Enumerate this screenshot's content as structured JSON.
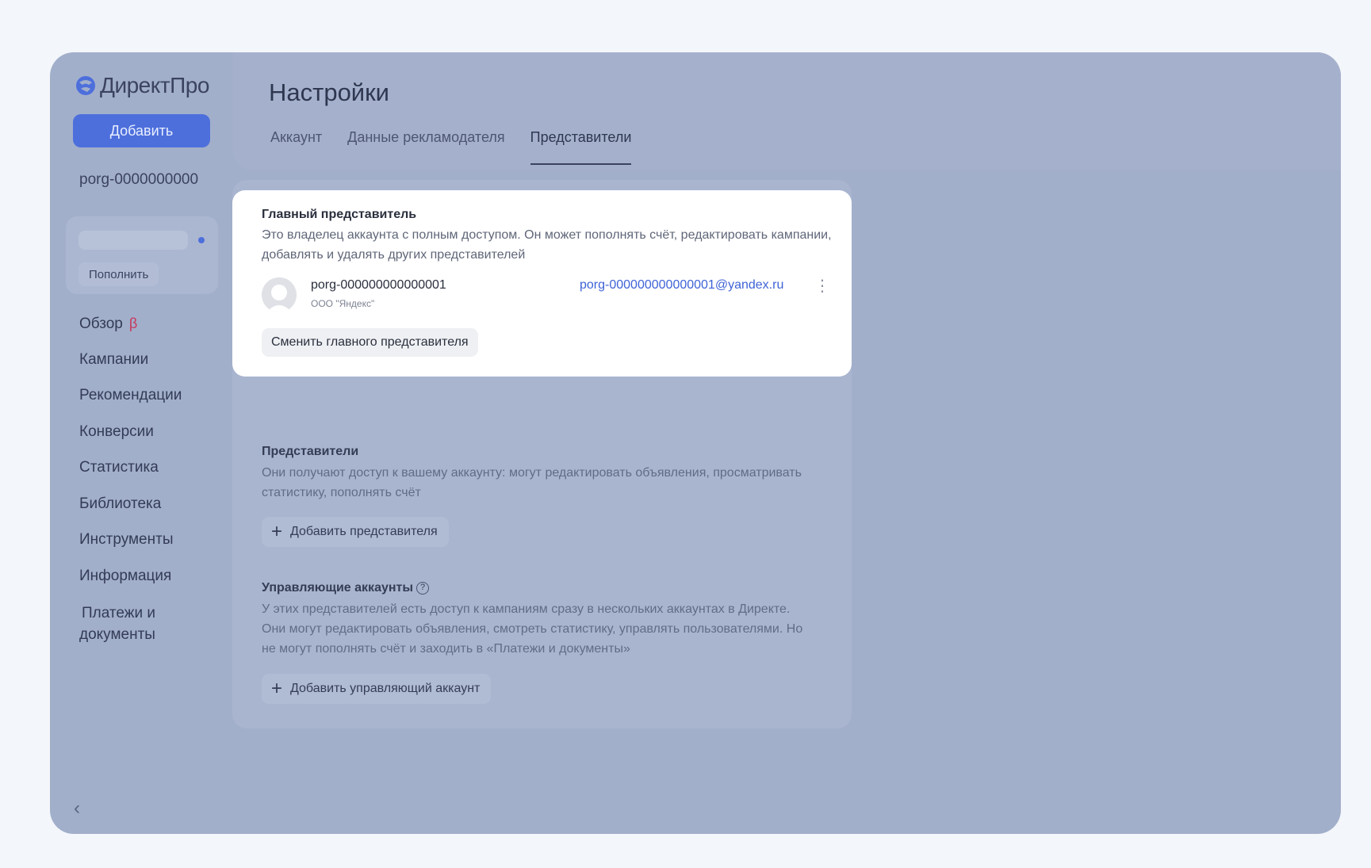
{
  "app": {
    "logo_text": "ДиректПро",
    "add_label": "Добавить",
    "account_id": "porg-0000000000",
    "topup_label": "Пополнить"
  },
  "nav": {
    "overview": "Обзор",
    "overview_badge": "β",
    "campaigns": "Кампании",
    "recommendations": "Рекомендации",
    "conversions": "Конверсии",
    "statistics": "Статистика",
    "library": "Библиотека",
    "tools": "Инструменты",
    "information": "Информация",
    "payments_line1": "Платежи и",
    "payments_line2": "документы"
  },
  "page": {
    "title": "Настройки",
    "tabs": [
      "Аккаунт",
      "Данные рекламодателя",
      "Представители"
    ],
    "active_tab": "Представители"
  },
  "main_rep": {
    "title": "Главный представитель",
    "description": "Это владелец аккаунта с полным доступом. Он может пополнять счёт, редактировать кампании, добавлять и удалять других представителей",
    "name": "porg-000000000000001",
    "org": "ООО \"Яндекс\"",
    "email": "porg-000000000000001@yandex.ru",
    "change_label": "Сменить главного представителя"
  },
  "reps": {
    "title": "Представители",
    "description": "Они получают доступ к вашему аккаунту: могут редактировать объявления, просматривать статистику, пополнять счёт",
    "add_label": "Добавить представителя"
  },
  "managing": {
    "title": "Управляющие аккаунты",
    "description": "У этих представителей есть доступ к кампаниям сразу в нескольких аккаунтах в Директе. Они могут редактировать объявления, смотреть статистику, управлять пользователями. Но не могут пополнять счёт и заходить в «Платежи и документы»",
    "add_label": "Добавить управляющий аккаунт"
  }
}
